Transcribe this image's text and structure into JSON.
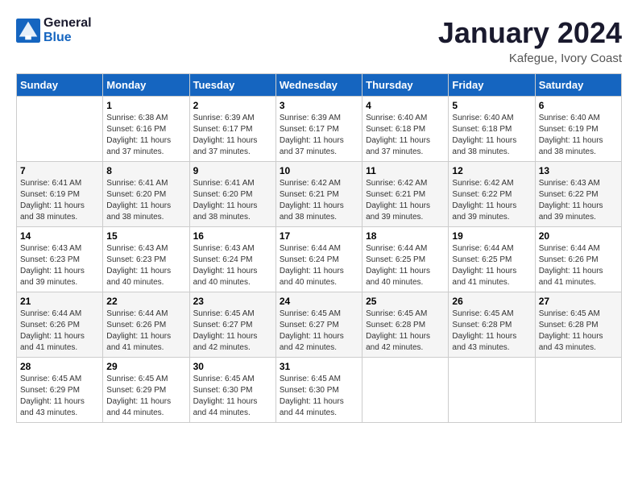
{
  "header": {
    "logo_line1": "General",
    "logo_line2": "Blue",
    "month": "January 2024",
    "location": "Kafegue, Ivory Coast"
  },
  "weekdays": [
    "Sunday",
    "Monday",
    "Tuesday",
    "Wednesday",
    "Thursday",
    "Friday",
    "Saturday"
  ],
  "weeks": [
    [
      {
        "day": "",
        "sunrise": "",
        "sunset": "",
        "daylight": ""
      },
      {
        "day": "1",
        "sunrise": "Sunrise: 6:38 AM",
        "sunset": "Sunset: 6:16 PM",
        "daylight": "Daylight: 11 hours and 37 minutes."
      },
      {
        "day": "2",
        "sunrise": "Sunrise: 6:39 AM",
        "sunset": "Sunset: 6:17 PM",
        "daylight": "Daylight: 11 hours and 37 minutes."
      },
      {
        "day": "3",
        "sunrise": "Sunrise: 6:39 AM",
        "sunset": "Sunset: 6:17 PM",
        "daylight": "Daylight: 11 hours and 37 minutes."
      },
      {
        "day": "4",
        "sunrise": "Sunrise: 6:40 AM",
        "sunset": "Sunset: 6:18 PM",
        "daylight": "Daylight: 11 hours and 37 minutes."
      },
      {
        "day": "5",
        "sunrise": "Sunrise: 6:40 AM",
        "sunset": "Sunset: 6:18 PM",
        "daylight": "Daylight: 11 hours and 38 minutes."
      },
      {
        "day": "6",
        "sunrise": "Sunrise: 6:40 AM",
        "sunset": "Sunset: 6:19 PM",
        "daylight": "Daylight: 11 hours and 38 minutes."
      }
    ],
    [
      {
        "day": "7",
        "sunrise": "Sunrise: 6:41 AM",
        "sunset": "Sunset: 6:19 PM",
        "daylight": "Daylight: 11 hours and 38 minutes."
      },
      {
        "day": "8",
        "sunrise": "Sunrise: 6:41 AM",
        "sunset": "Sunset: 6:20 PM",
        "daylight": "Daylight: 11 hours and 38 minutes."
      },
      {
        "day": "9",
        "sunrise": "Sunrise: 6:41 AM",
        "sunset": "Sunset: 6:20 PM",
        "daylight": "Daylight: 11 hours and 38 minutes."
      },
      {
        "day": "10",
        "sunrise": "Sunrise: 6:42 AM",
        "sunset": "Sunset: 6:21 PM",
        "daylight": "Daylight: 11 hours and 38 minutes."
      },
      {
        "day": "11",
        "sunrise": "Sunrise: 6:42 AM",
        "sunset": "Sunset: 6:21 PM",
        "daylight": "Daylight: 11 hours and 39 minutes."
      },
      {
        "day": "12",
        "sunrise": "Sunrise: 6:42 AM",
        "sunset": "Sunset: 6:22 PM",
        "daylight": "Daylight: 11 hours and 39 minutes."
      },
      {
        "day": "13",
        "sunrise": "Sunrise: 6:43 AM",
        "sunset": "Sunset: 6:22 PM",
        "daylight": "Daylight: 11 hours and 39 minutes."
      }
    ],
    [
      {
        "day": "14",
        "sunrise": "Sunrise: 6:43 AM",
        "sunset": "Sunset: 6:23 PM",
        "daylight": "Daylight: 11 hours and 39 minutes."
      },
      {
        "day": "15",
        "sunrise": "Sunrise: 6:43 AM",
        "sunset": "Sunset: 6:23 PM",
        "daylight": "Daylight: 11 hours and 40 minutes."
      },
      {
        "day": "16",
        "sunrise": "Sunrise: 6:43 AM",
        "sunset": "Sunset: 6:24 PM",
        "daylight": "Daylight: 11 hours and 40 minutes."
      },
      {
        "day": "17",
        "sunrise": "Sunrise: 6:44 AM",
        "sunset": "Sunset: 6:24 PM",
        "daylight": "Daylight: 11 hours and 40 minutes."
      },
      {
        "day": "18",
        "sunrise": "Sunrise: 6:44 AM",
        "sunset": "Sunset: 6:25 PM",
        "daylight": "Daylight: 11 hours and 40 minutes."
      },
      {
        "day": "19",
        "sunrise": "Sunrise: 6:44 AM",
        "sunset": "Sunset: 6:25 PM",
        "daylight": "Daylight: 11 hours and 41 minutes."
      },
      {
        "day": "20",
        "sunrise": "Sunrise: 6:44 AM",
        "sunset": "Sunset: 6:26 PM",
        "daylight": "Daylight: 11 hours and 41 minutes."
      }
    ],
    [
      {
        "day": "21",
        "sunrise": "Sunrise: 6:44 AM",
        "sunset": "Sunset: 6:26 PM",
        "daylight": "Daylight: 11 hours and 41 minutes."
      },
      {
        "day": "22",
        "sunrise": "Sunrise: 6:44 AM",
        "sunset": "Sunset: 6:26 PM",
        "daylight": "Daylight: 11 hours and 41 minutes."
      },
      {
        "day": "23",
        "sunrise": "Sunrise: 6:45 AM",
        "sunset": "Sunset: 6:27 PM",
        "daylight": "Daylight: 11 hours and 42 minutes."
      },
      {
        "day": "24",
        "sunrise": "Sunrise: 6:45 AM",
        "sunset": "Sunset: 6:27 PM",
        "daylight": "Daylight: 11 hours and 42 minutes."
      },
      {
        "day": "25",
        "sunrise": "Sunrise: 6:45 AM",
        "sunset": "Sunset: 6:28 PM",
        "daylight": "Daylight: 11 hours and 42 minutes."
      },
      {
        "day": "26",
        "sunrise": "Sunrise: 6:45 AM",
        "sunset": "Sunset: 6:28 PM",
        "daylight": "Daylight: 11 hours and 43 minutes."
      },
      {
        "day": "27",
        "sunrise": "Sunrise: 6:45 AM",
        "sunset": "Sunset: 6:28 PM",
        "daylight": "Daylight: 11 hours and 43 minutes."
      }
    ],
    [
      {
        "day": "28",
        "sunrise": "Sunrise: 6:45 AM",
        "sunset": "Sunset: 6:29 PM",
        "daylight": "Daylight: 11 hours and 43 minutes."
      },
      {
        "day": "29",
        "sunrise": "Sunrise: 6:45 AM",
        "sunset": "Sunset: 6:29 PM",
        "daylight": "Daylight: 11 hours and 44 minutes."
      },
      {
        "day": "30",
        "sunrise": "Sunrise: 6:45 AM",
        "sunset": "Sunset: 6:30 PM",
        "daylight": "Daylight: 11 hours and 44 minutes."
      },
      {
        "day": "31",
        "sunrise": "Sunrise: 6:45 AM",
        "sunset": "Sunset: 6:30 PM",
        "daylight": "Daylight: 11 hours and 44 minutes."
      },
      {
        "day": "",
        "sunrise": "",
        "sunset": "",
        "daylight": ""
      },
      {
        "day": "",
        "sunrise": "",
        "sunset": "",
        "daylight": ""
      },
      {
        "day": "",
        "sunrise": "",
        "sunset": "",
        "daylight": ""
      }
    ]
  ]
}
